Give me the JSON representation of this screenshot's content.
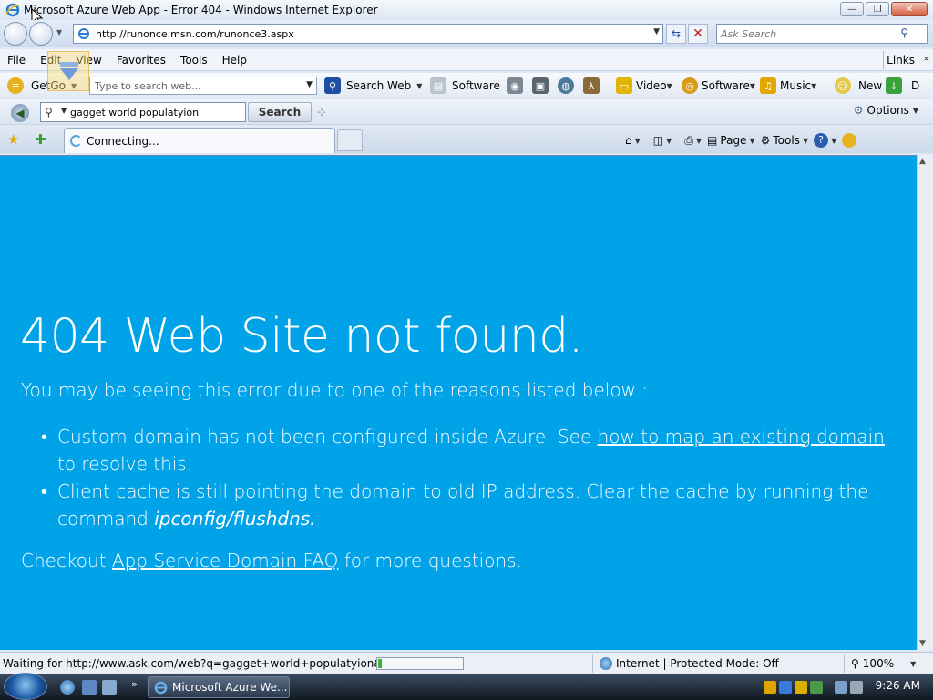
{
  "window": {
    "title": "Microsoft Azure Web App - Error 404 - Windows Internet Explorer",
    "minimize": "—",
    "maximize": "❐",
    "close": "✕"
  },
  "address": {
    "url": "http://runonce.msn.com/runonce3.aspx",
    "search_placeholder": "Ask Search"
  },
  "menu": {
    "items": [
      "File",
      "Edit",
      "View",
      "Favorites",
      "Tools",
      "Help"
    ],
    "links": "Links"
  },
  "toolbar1": {
    "getgo": "GetGo",
    "web_placeholder": "Type to search web...",
    "search_web": "Search Web",
    "software": "Software",
    "video": "Video",
    "software2": "Software",
    "music": "Music",
    "new": "New",
    "d": "D"
  },
  "toolbar2": {
    "query": "gagget world populatyion",
    "search_button": "Search",
    "options": "Options"
  },
  "tab": {
    "label": "Connecting...",
    "cmd": {
      "page": "Page",
      "tools": "Tools"
    }
  },
  "page": {
    "heading": "404 Web Site not found.",
    "subheading": "You may be seeing this error due to one of the reasons listed below :",
    "bullet1_pre": "Custom domain has not been configured inside Azure. See ",
    "bullet1_link": "how to map an existing domain",
    "bullet1_post": " to resolve this.",
    "bullet2_pre": "Client cache is still pointing the domain to old IP address. Clear the cache by running the command ",
    "bullet2_cmd": "ipconfig/flushdns.",
    "faq_pre": "Checkout ",
    "faq_link": "App Service Domain FAQ",
    "faq_post": " for more questions.",
    "bg_color": "#00a2e8"
  },
  "status": {
    "text": "Waiting for http://www.ask.com/web?q=gagget+world+populatyion&o=&l=",
    "progress_fraction": 0.04,
    "zone": "Internet | Protected Mode: Off",
    "zoom": "100%"
  },
  "taskbar": {
    "task_label": "Microsoft Azure We...",
    "clock": "9:26 AM"
  }
}
